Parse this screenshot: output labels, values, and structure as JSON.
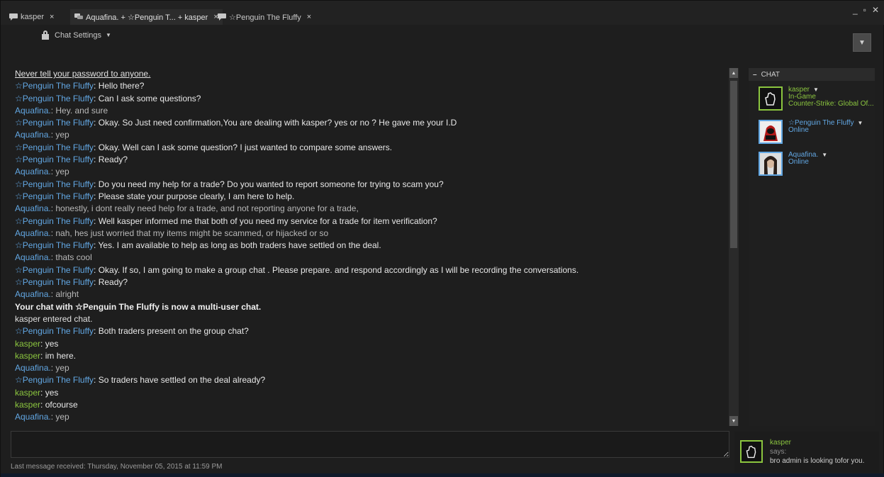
{
  "tabs": [
    {
      "label": "kasper",
      "close": "×"
    },
    {
      "label": "Aquafina. + ☆Penguin T... + kasper",
      "close": "×"
    },
    {
      "label": "☆Penguin The Fluffy",
      "close": "×"
    }
  ],
  "window_controls": {
    "minimize": "_",
    "restore": "▫",
    "close": "✕"
  },
  "settings": {
    "label": "Chat Settings",
    "caret": "▼"
  },
  "top_dropdown": "▼",
  "messages": [
    {
      "type": "warning",
      "text": "Never tell your password to anyone."
    },
    {
      "type": "msg",
      "name": "☆Penguin The Fluffy",
      "color": "blue",
      "text": ": Hello there?",
      "tcolor": "white"
    },
    {
      "type": "msg",
      "name": "☆Penguin The Fluffy",
      "color": "blue",
      "text": ": Can I ask some questions?",
      "tcolor": "white"
    },
    {
      "type": "msg",
      "name": "Aquafina.",
      "color": "blue",
      "text": ": Hey. and sure",
      "tcolor": "gray"
    },
    {
      "type": "msg",
      "name": "☆Penguin The Fluffy",
      "color": "blue",
      "text": ": Okay. So Just need confirmation,You are dealing with kasper? yes or no ? He gave me your I.D",
      "tcolor": "white"
    },
    {
      "type": "msg",
      "name": "Aquafina.",
      "color": "blue",
      "text": ": yep",
      "tcolor": "gray"
    },
    {
      "type": "msg",
      "name": "☆Penguin The Fluffy",
      "color": "blue",
      "text": ": Okay. Well can I ask some question? I just wanted to compare some answers.",
      "tcolor": "white"
    },
    {
      "type": "msg",
      "name": "☆Penguin The Fluffy",
      "color": "blue",
      "text": ": Ready?",
      "tcolor": "white"
    },
    {
      "type": "msg",
      "name": "Aquafina.",
      "color": "blue",
      "text": ": yep",
      "tcolor": "gray"
    },
    {
      "type": "msg",
      "name": "☆Penguin The Fluffy",
      "color": "blue",
      "text": ": Do you need my help for a trade? Do you  wanted to report someone for trying to scam you?",
      "tcolor": "white"
    },
    {
      "type": "msg",
      "name": "☆Penguin The Fluffy",
      "color": "blue",
      "text": ": Please state your purpose clearly, I am here to help.",
      "tcolor": "white"
    },
    {
      "type": "msg",
      "name": "Aquafina.",
      "color": "blue",
      "text": ": honestly, i dont really need help for a trade, and not reporting anyone for a trade,",
      "tcolor": "gray"
    },
    {
      "type": "msg",
      "name": "☆Penguin The Fluffy",
      "color": "blue",
      "text": ": Well kasper informed me that both of you need my service for a trade for item verification?",
      "tcolor": "white"
    },
    {
      "type": "msg",
      "name": "Aquafina.",
      "color": "blue",
      "text": ": nah, hes just worried that my items might be scammed, or hijacked or so",
      "tcolor": "gray"
    },
    {
      "type": "msg",
      "name": "☆Penguin The Fluffy",
      "color": "blue",
      "text": ": Yes. I am available to help as long as both traders have settled on the deal.",
      "tcolor": "white"
    },
    {
      "type": "msg",
      "name": "Aquafina.",
      "color": "blue",
      "text": ": thats cool",
      "tcolor": "gray"
    },
    {
      "type": "msg",
      "name": "☆Penguin The Fluffy",
      "color": "blue",
      "text": ": Okay. If so, I am going to make a group chat . Please prepare. and respond accordingly as I will be recording the conversations.",
      "tcolor": "white"
    },
    {
      "type": "msg",
      "name": "☆Penguin The Fluffy",
      "color": "blue",
      "text": ": Ready?",
      "tcolor": "white"
    },
    {
      "type": "msg",
      "name": "Aquafina.",
      "color": "blue",
      "text": ": alright",
      "tcolor": "gray"
    },
    {
      "type": "sysbold",
      "text": "Your chat with ☆Penguin The Fluffy is now a multi-user chat."
    },
    {
      "type": "sys",
      "text": "kasper entered chat."
    },
    {
      "type": "msg",
      "name": "☆Penguin The Fluffy",
      "color": "blue",
      "text": ": Both traders present on the group chat?",
      "tcolor": "white"
    },
    {
      "type": "msg",
      "name": "kasper",
      "color": "green",
      "text": ": yes",
      "tcolor": "white"
    },
    {
      "type": "msg",
      "name": "kasper",
      "color": "green",
      "text": ": im here.",
      "tcolor": "white"
    },
    {
      "type": "msg",
      "name": "Aquafina.",
      "color": "blue",
      "text": ": yep",
      "tcolor": "gray"
    },
    {
      "type": "msg",
      "name": "☆Penguin The Fluffy",
      "color": "blue",
      "text": ": So traders have settled on the deal already?",
      "tcolor": "white"
    },
    {
      "type": "msg",
      "name": "kasper",
      "color": "green",
      "text": ": yes",
      "tcolor": "white"
    },
    {
      "type": "msg",
      "name": "kasper",
      "color": "green",
      "text": ": ofcourse",
      "tcolor": "white"
    },
    {
      "type": "msg",
      "name": "Aquafina.",
      "color": "blue",
      "text": ": yep",
      "tcolor": "gray"
    }
  ],
  "scroll": {
    "up": "▲",
    "down": "▼"
  },
  "input": {
    "value": ""
  },
  "last_message": "Last message received: Thursday, November 05, 2015 at 11:59 PM",
  "panel": {
    "header": "CHAT",
    "collapse": "–",
    "members": [
      {
        "name": "kasper",
        "status1": "In-Game",
        "status2": "Counter-Strike: Global Of...",
        "color": "green",
        "caret": "▼"
      },
      {
        "name": "☆Penguin The Fluffy",
        "status1": "Online",
        "status2": "",
        "color": "blue",
        "caret": "▼"
      },
      {
        "name": "Aquafina.",
        "status1": "Online",
        "status2": "",
        "color": "blue",
        "caret": "▼"
      }
    ]
  },
  "notification": {
    "name": "kasper",
    "says": "says:",
    "message": "bro admin is looking tofor you."
  },
  "colors": {
    "online_blue": "#62a7e3",
    "ingame_green": "#8bc53f",
    "background": "#1e1e1e"
  }
}
